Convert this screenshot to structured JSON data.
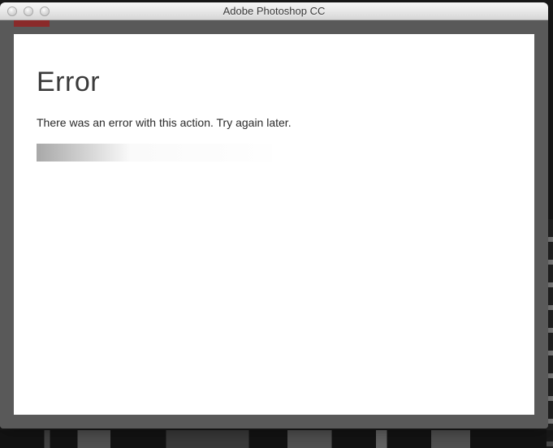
{
  "window": {
    "title": "Adobe Photoshop CC"
  },
  "dialog": {
    "heading": "Error",
    "message": "There was an error with this action. Try again later."
  }
}
